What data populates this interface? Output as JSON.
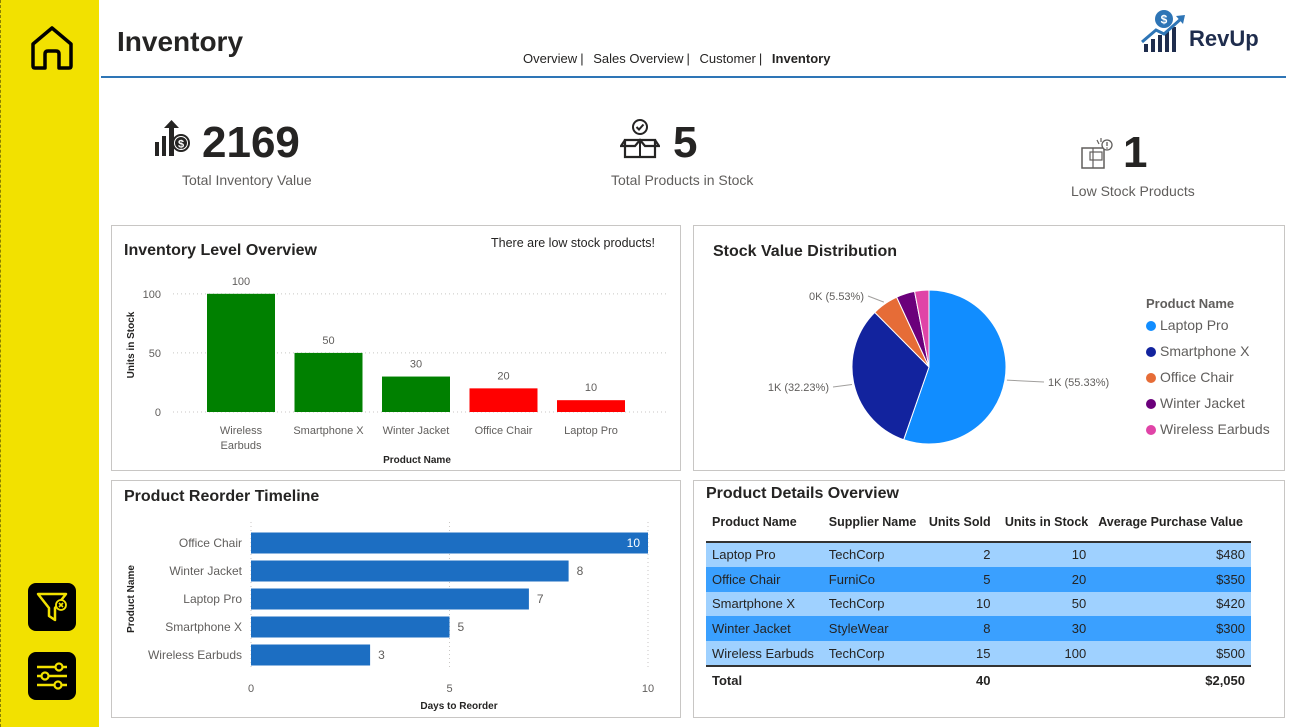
{
  "header": {
    "title": "Inventory",
    "nav": [
      "Overview",
      "Sales Overview",
      "Customer",
      "Inventory"
    ],
    "nav_separator": "|",
    "logo_text": "RevUp"
  },
  "kpis": {
    "total_inventory_value": {
      "value": "2169",
      "label": "Total Inventory Value"
    },
    "total_products": {
      "value": "5",
      "label": "Total Products in Stock"
    },
    "low_stock": {
      "value": "1",
      "label": "Low Stock Products"
    }
  },
  "panels": {
    "inventory_level": {
      "title": "Inventory Level Overview",
      "note": "There are low stock products!"
    },
    "stock_value": {
      "title": "Stock Value Distribution"
    },
    "reorder": {
      "title": "Product Reorder Timeline"
    },
    "details": {
      "title": "Product Details Overview"
    }
  },
  "chart_data": [
    {
      "type": "bar",
      "title": "Inventory Level Overview",
      "categories": [
        "Wireless Earbuds",
        "Smartphone X",
        "Winter Jacket",
        "Office Chair",
        "Laptop Pro"
      ],
      "values": [
        100,
        50,
        30,
        20,
        10
      ],
      "bar_colors": [
        "#008000",
        "#008000",
        "#008000",
        "#ff0000",
        "#ff0000"
      ],
      "xlabel": "Product Name",
      "ylabel": "Units in Stock",
      "yticks": [
        0,
        50,
        100
      ],
      "ylim": [
        0,
        110
      ]
    },
    {
      "type": "pie",
      "title": "Stock Value Distribution",
      "legend_title": "Product Name",
      "slices": [
        {
          "name": "Laptop Pro",
          "percent": 55.33,
          "label": "1K (55.33%)",
          "color": "#118dff"
        },
        {
          "name": "Smartphone X",
          "percent": 32.23,
          "label": "1K (32.23%)",
          "color": "#12239e"
        },
        {
          "name": "Office Chair",
          "percent": 5.53,
          "label": "0K (5.53%)",
          "color": "#e66c37"
        },
        {
          "name": "Winter Jacket",
          "percent": 3.91,
          "label": "",
          "color": "#6b007b"
        },
        {
          "name": "Wireless Earbuds",
          "percent": 3.0,
          "label": "",
          "color": "#e044a7"
        }
      ]
    },
    {
      "type": "bar",
      "orientation": "horizontal",
      "title": "Product Reorder Timeline",
      "categories": [
        "Office Chair",
        "Winter Jacket",
        "Laptop Pro",
        "Smartphone X",
        "Wireless Earbuds"
      ],
      "values": [
        10,
        8,
        7,
        5,
        3
      ],
      "color": "#1c6ec2",
      "xlabel": "Days to Reorder",
      "ylabel": "Product Name",
      "xticks": [
        0,
        5,
        10
      ],
      "xlim": [
        0,
        10
      ]
    }
  ],
  "table": {
    "columns": [
      "Product Name",
      "Supplier Name",
      "Units Sold",
      "Units in Stock",
      "Average Purchase Value"
    ],
    "rows": [
      [
        "Laptop Pro",
        "TechCorp",
        "2",
        "10",
        "$480"
      ],
      [
        "Office Chair",
        "FurniCo",
        "5",
        "20",
        "$350"
      ],
      [
        "Smartphone X",
        "TechCorp",
        "10",
        "50",
        "$420"
      ],
      [
        "Winter Jacket",
        "StyleWear",
        "8",
        "30",
        "$300"
      ],
      [
        "Wireless Earbuds",
        "TechCorp",
        "15",
        "100",
        "$500"
      ]
    ],
    "total": [
      "Total",
      "",
      "40",
      "",
      "$2,050"
    ]
  },
  "icons": {
    "home": "home-icon",
    "filter": "filter-clear-icon",
    "settings": "sliders-icon"
  }
}
